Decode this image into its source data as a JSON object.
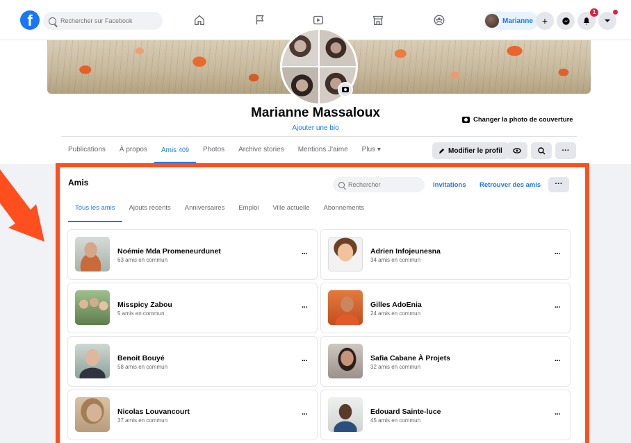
{
  "topbar": {
    "logo": "f",
    "search_placeholder": "Rechercher sur Facebook",
    "user_name": "Marianne",
    "notifications_count": "1"
  },
  "profile": {
    "name": "Marianne Massaloux",
    "bio_link": "Ajouter une bio",
    "cover_button": "Changer la photo de couverture",
    "tabs": [
      {
        "label": "Publications"
      },
      {
        "label": "À propos"
      },
      {
        "label": "Amis",
        "count": "409"
      },
      {
        "label": "Photos"
      },
      {
        "label": "Archive stories"
      },
      {
        "label": "Mentions J'aime"
      },
      {
        "label": "Plus ▾"
      }
    ],
    "edit_button": "Modifier le profil",
    "more_button": "···"
  },
  "friends": {
    "title": "Amis",
    "search_placeholder": "Rechercher",
    "invitations": "Invitations",
    "find_friends": "Retrouver des amis",
    "more": "···",
    "tabs": [
      "Tous les amis",
      "Ajouts récents",
      "Anniversaires",
      "Emploi",
      "Ville actuelle",
      "Abonnements"
    ],
    "list": [
      {
        "name": "Noémie Mda Promeneurdunet",
        "mutual": "63 amis en commun"
      },
      {
        "name": "Adrien Infojeunesna",
        "mutual": "34 amis en commun"
      },
      {
        "name": "Misspicy Zabou",
        "mutual": "5 amis en commun"
      },
      {
        "name": "Gilles AdoEnia",
        "mutual": "24 amis en commun"
      },
      {
        "name": "Benoit Bouyé",
        "mutual": "58 amis en commun"
      },
      {
        "name": "Safia Cabane À Projets",
        "mutual": "32 amis en commun"
      },
      {
        "name": "Nicolas Louvancourt",
        "mutual": "37 amis en commun"
      },
      {
        "name": "Edouard Sainte-luce",
        "mutual": "45 amis en commun"
      }
    ],
    "card_menu": "···"
  },
  "colors": {
    "brand": "#1877f2",
    "highlight": "#ff4f1f",
    "background": "#f0f2f5"
  }
}
